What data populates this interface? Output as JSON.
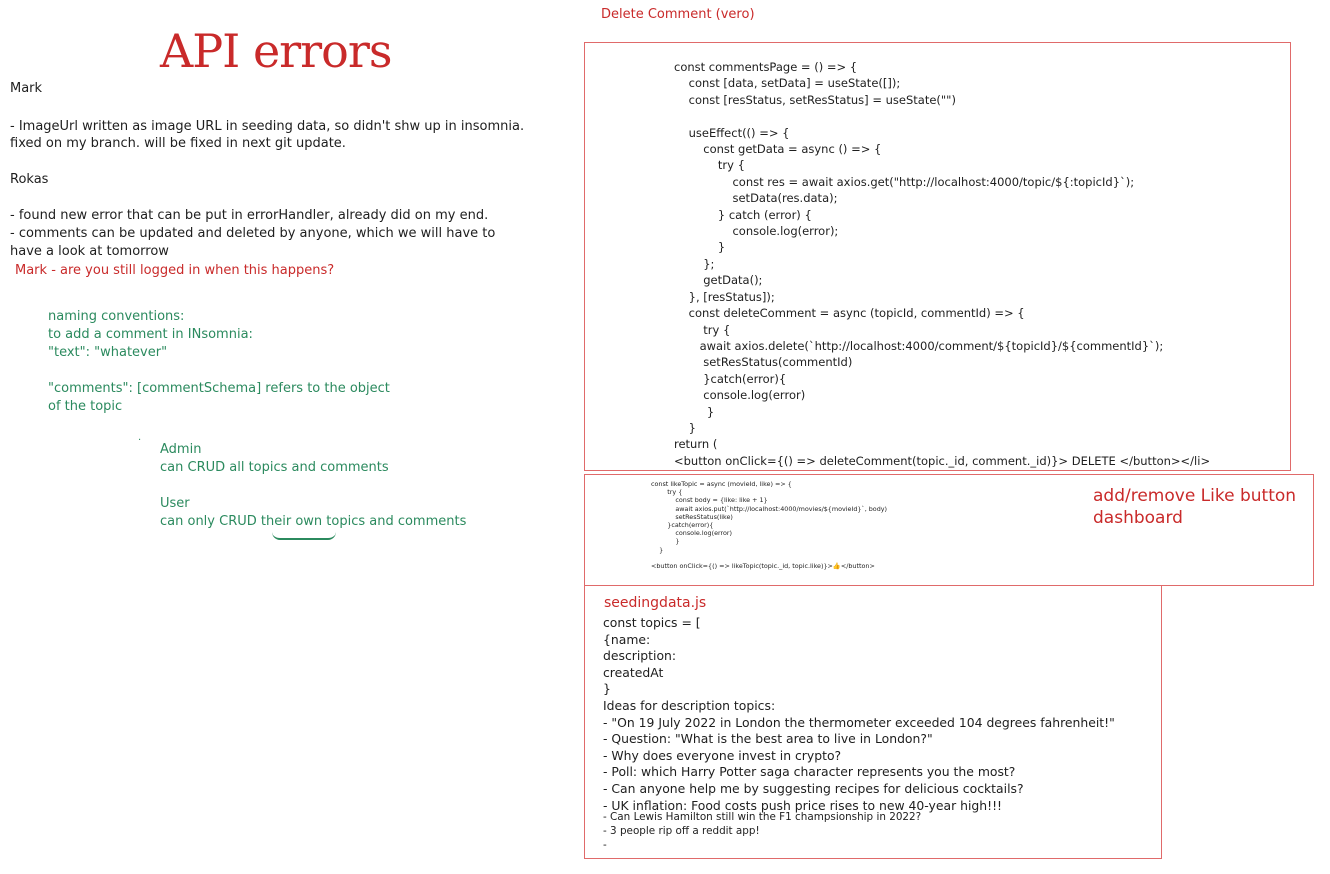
{
  "left": {
    "title": "API errors",
    "mark_name": "Mark",
    "mark_notes": [
      "- ImageUrl written as image URL in seeding data, so didn't shw up in insomnia.",
      "fixed on my branch. will be fixed in next git update."
    ],
    "rokas_name": "Rokas",
    "rokas_notes": [
      "- found new error that can be put in errorHandler, already did on my end.",
      "- comments can be updated and deleted by anyone, which we will have to",
      "have a look at tomorrow"
    ],
    "question": "Mark - are you still logged in when this happens?",
    "naming_conventions": [
      "naming conventions:",
      "to add a comment in INsomnia:",
      "\"text\": \"whatever\"",
      "",
      "\"comments\": [commentSchema] refers to the object",
      "of the topic"
    ],
    "dot": "·",
    "admin_label": "Admin",
    "admin_desc": "can CRUD all topics and comments",
    "user_label": "User",
    "user_desc_prefix": "can only CRUD ",
    "user_desc_underline": "their own",
    "user_desc_suffix": " topics and comments"
  },
  "delete_comment": {
    "label": "Delete Comment (vero)",
    "code": [
      "const commentsPage = () => {",
      "    const [data, setData] = useState([]);",
      "    const [resStatus, setResStatus] = useState(\"\")",
      "",
      "    useEffect(() => {",
      "        const getData = async () => {",
      "            try {",
      "                const res = await axios.get(\"http://localhost:4000/topic/${:topicId}`);",
      "                setData(res.data);",
      "            } catch (error) {",
      "                console.log(error);",
      "            }",
      "        };",
      "        getData();",
      "    }, [resStatus]);",
      "    const deleteComment = async (topicId, commentId) => {",
      "        try {",
      "       await axios.delete(`http://localhost:4000/comment/${topicId}/${commentId}`);",
      "        setResStatus(commentId)",
      "        }catch(error){",
      "        console.log(error)",
      "         }",
      "    }",
      "return (",
      "<button onClick={() => deleteComment(topic._id, comment._id)}> DELETE </button></li>"
    ]
  },
  "like_button": {
    "label_line1": "add/remove Like button",
    "label_line2": "dashboard",
    "code": [
      "const likeTopic = async (movieId, like) => {",
      "        try {",
      "            const body = {like: like + 1}",
      "            await axios.put(`http://localhost:4000/movies/${movieId}`, body)",
      "            setResStatus(like)",
      "        }catch(error){",
      "            console.log(error)",
      "            }",
      "    }",
      "",
      "<button onClick={() => likeTopic(topic._id, topic.like)}>👍</button>"
    ]
  },
  "seeding": {
    "label": "seedingdata.js",
    "lines": [
      "const topics = [",
      "{name:",
      "description:",
      "createdAt",
      "}",
      "Ideas for description topics:",
      "- \"On 19 July 2022 in London the thermometer exceeded 104 degrees fahrenheit!\"",
      "- Question: \"What is the best area to live in London?\"",
      "- Why does everyone invest in crypto?",
      "- Poll: which Harry Potter saga character represents you the most?",
      "- Can anyone help me by suggesting recipes for delicious cocktails?",
      "- UK inflation: Food costs push price rises to new 40-year high!!!"
    ],
    "small_lines": [
      "- Can Lewis Hamilton still win the F1 champsionship in 2022?",
      "- 3 people rip off a reddit app!",
      "-"
    ]
  },
  "colors": {
    "accent_red": "#c92a2a",
    "note_green": "#2b8a5e",
    "box_border": "#e06a6a"
  }
}
